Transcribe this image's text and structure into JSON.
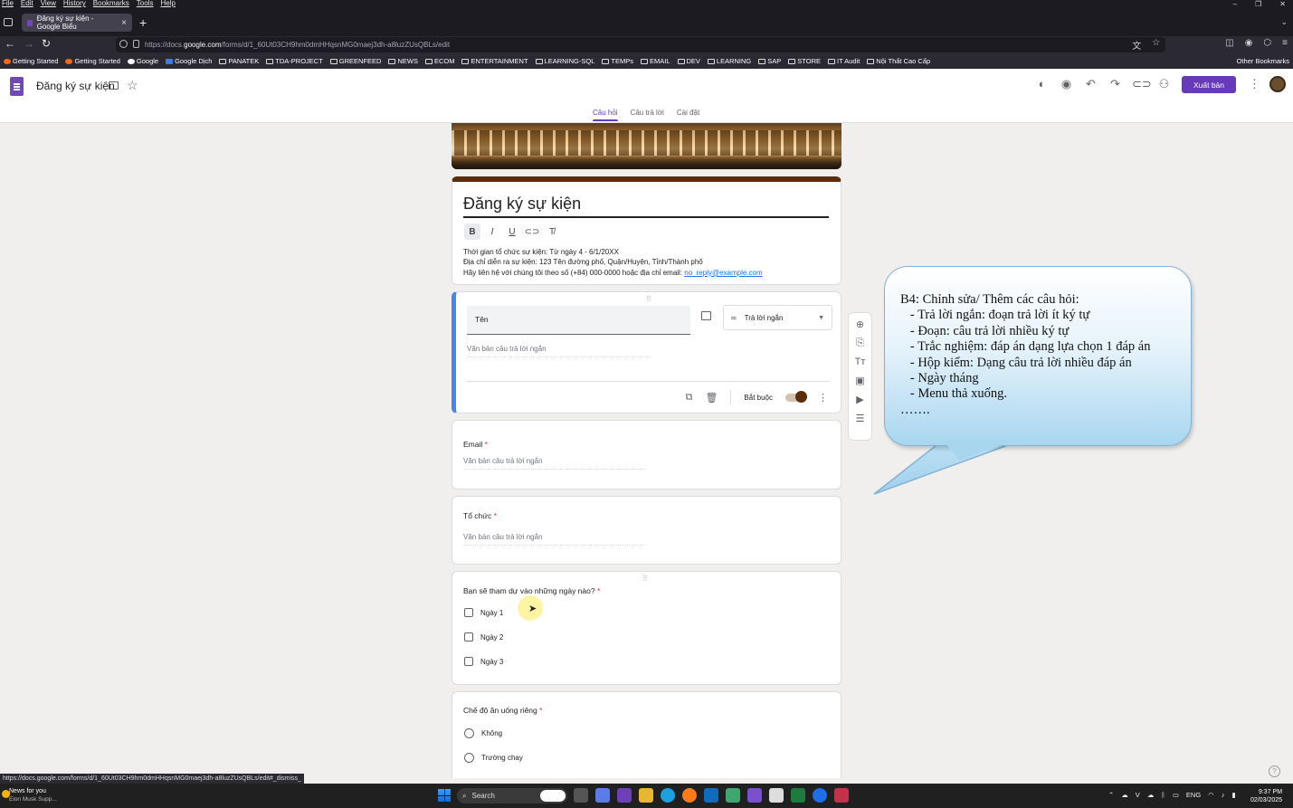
{
  "browser": {
    "menu": [
      "File",
      "Edit",
      "View",
      "History",
      "Bookmarks",
      "Tools",
      "Help"
    ],
    "tab_title": "Đăng ký sự kiện - Google Biểu",
    "url_prefix": "https://docs.",
    "url_host": "google.com",
    "url_rest": "/forms/d/1_60Ut03CH9hm0dmHHqsnMG0maej3dh-a8luzZUsQBLs/edit",
    "bookmarks": [
      "Getting Started",
      "Getting Started",
      "Google",
      "Google Dịch",
      "PANATEK",
      "TDA-PROJECT",
      "GREENFEED",
      "NEWS",
      "ECOM",
      "ENTERTAINMENT",
      "LEARNING-SQL",
      "TEMPs",
      "EMAIL",
      "DEV",
      "LEARNING",
      "SAP",
      "STORE",
      "IT Audit",
      "Nội Thất Cao Cấp"
    ],
    "other_bookmarks": "Other Bookmarks",
    "status_url": "https://docs.google.com/forms/d/1_60Ut03CH9hm0dmHHqsnMG0maej3dh-a8luzZUsQBLs/edit#_dismiss_"
  },
  "header": {
    "doc_title": "Đăng ký sự kiện",
    "publish_label": "Xuất bản",
    "tabs": [
      "Câu hỏi",
      "Câu trả lời",
      "Cài đặt"
    ]
  },
  "form": {
    "title": "Đăng ký sự kiện",
    "desc": [
      "Thời gian tổ chức sự kiện: Từ ngày 4 - 6/1/20XX",
      "Địa chỉ diễn ra sự kiện: 123 Tên đường phố, Quận/Huyện, Tỉnh/Thành phố",
      "Hãy liên hệ với chúng tôi theo số (+84) 000-0000 hoặc địa chỉ email: "
    ],
    "email_link": "no_reply@example.com",
    "active_q": {
      "title": "Tên",
      "type": "Trả lời ngắn",
      "placeholder": "Văn bản câu trả lời ngắn",
      "required_label": "Bắt buộc"
    },
    "q_email": {
      "label": "Email",
      "placeholder": "Văn bản câu trả lời ngắn"
    },
    "q_org": {
      "label": "Tổ chức",
      "placeholder": "Văn bản câu trả lời ngắn"
    },
    "q_days": {
      "label": "Bạn sẽ tham dự vào những ngày nào?",
      "options": [
        "Ngày 1",
        "Ngày 2",
        "Ngày 3"
      ]
    },
    "q_diet": {
      "label": "Chế độ ăn uống riêng",
      "options": [
        "Không",
        "Trường chay"
      ]
    },
    "required_mark": "*"
  },
  "callout": {
    "text": "B4: Chỉnh sửa/ Thêm các câu hỏi:\n   - Trả lời ngắn: đoạn trả lời ít ký tự\n   - Đoạn: câu trả lời nhiều ký tự\n   - Trắc nghiệm: đáp án dạng lựa chọn 1 đáp án\n   - Hộp kiểm: Dạng câu trả lời nhiều đáp án\n   - Ngày tháng\n   - Menu thả xuống.\n……."
  },
  "taskbar": {
    "news_title": "News for you",
    "news_sub": "Elon Musk Supp...",
    "search": "Search",
    "lang": "ENG",
    "time": "9:37 PM",
    "date": "02/03/2025"
  },
  "colors": {
    "accent": "#673ab7",
    "theme": "#5c2d0a",
    "required": "#d93025",
    "active_border": "#4285f4"
  }
}
